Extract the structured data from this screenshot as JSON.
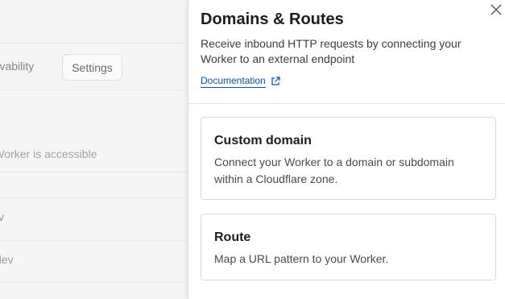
{
  "background": {
    "tabs": [
      {
        "label": "servability"
      },
      {
        "label": "Settings"
      }
    ],
    "description": "ur Worker is accessible",
    "rows": [
      {
        "text": ""
      },
      {
        "text": "v"
      },
      {
        "text": "dev"
      }
    ]
  },
  "panel": {
    "title": "Domains & Routes",
    "description": "Receive inbound HTTP requests by connecting your Worker to an external endpoint",
    "doc_link": "Documentation",
    "cards": [
      {
        "title": "Custom domain",
        "description": "Connect your Worker to a domain or subdomain within a Cloudflare zone."
      },
      {
        "title": "Route",
        "description": "Map a URL pattern to your Worker."
      }
    ]
  }
}
